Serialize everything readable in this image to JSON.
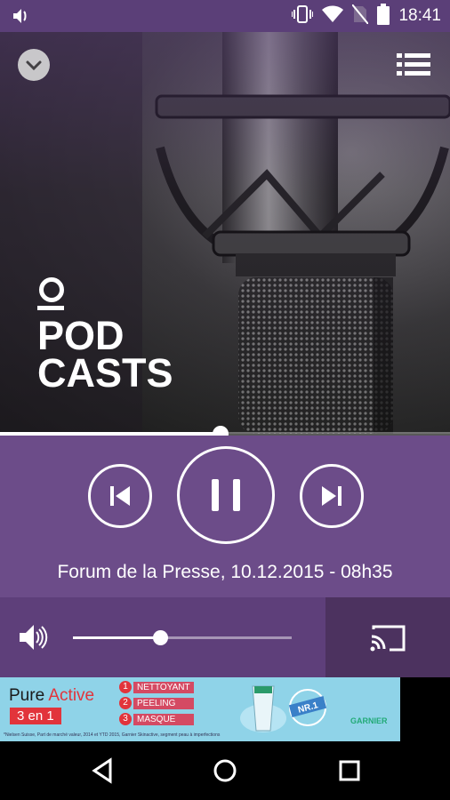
{
  "status": {
    "time": "18:41",
    "icons": [
      "notification-volume-icon",
      "vibrate-icon",
      "wifi-icon",
      "no-sim-icon",
      "battery-icon"
    ]
  },
  "player": {
    "logo_lines": [
      "POD",
      "CASTS"
    ],
    "track_title": "Forum de la Presse, 10.12.2015 - 08h35",
    "progress": 0.49,
    "volume": 0.4,
    "colors": {
      "top": "#5b3f78",
      "controls": "#6c4c89",
      "volume": "#5e3f7a",
      "cast": "#4c325f"
    }
  },
  "ad": {
    "brand_pre": "Pure ",
    "brand_accent": "Active",
    "badge": "3 en 1",
    "items": [
      {
        "num": "1",
        "label": "NETTOYANT"
      },
      {
        "num": "2",
        "label": "PEELING"
      },
      {
        "num": "3",
        "label": "MASQUE"
      }
    ],
    "nr1": "NR.1",
    "logo": "GARNIER",
    "fine_print": "*Nielsen Suisse, Part de marché valeur, 2014 et YTD 2015, Garnier Skinactive, segment peau à imperfections"
  }
}
